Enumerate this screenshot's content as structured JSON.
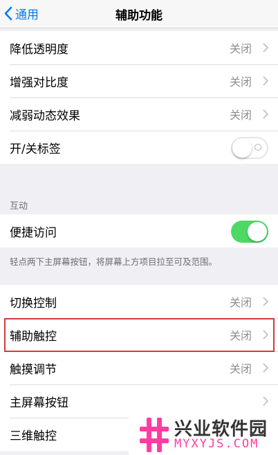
{
  "navbar": {
    "back_label": "通用",
    "title": "辅助功能"
  },
  "group1": {
    "rows": [
      {
        "label": "降低透明度",
        "value": "关闭"
      },
      {
        "label": "增强对比度",
        "value": "关闭"
      },
      {
        "label": "减弱动态效果",
        "value": "关闭"
      },
      {
        "label": "开/关标签",
        "toggle": "off"
      }
    ]
  },
  "interaction": {
    "header": "互动",
    "reachability": {
      "label": "便捷访问",
      "toggle": "on"
    },
    "footer": "轻点两下主屏幕按钮，将屏幕上方项目拉至可及范围。"
  },
  "group3": {
    "rows": [
      {
        "label": "切换控制",
        "value": "关闭"
      },
      {
        "label": "辅助触控",
        "value": "关闭",
        "highlighted": true
      },
      {
        "label": "触摸调节",
        "value": "关闭"
      },
      {
        "label": "主屏幕按钮"
      },
      {
        "label": "三维触控"
      }
    ]
  },
  "watermark": {
    "name": "兴业软件园",
    "url": "MYXYJS.COM"
  },
  "colors": {
    "accent": "#007aff",
    "toggle_on": "#4cd964",
    "highlight": "#d2393a",
    "watermark_url": "#ff3da0"
  }
}
